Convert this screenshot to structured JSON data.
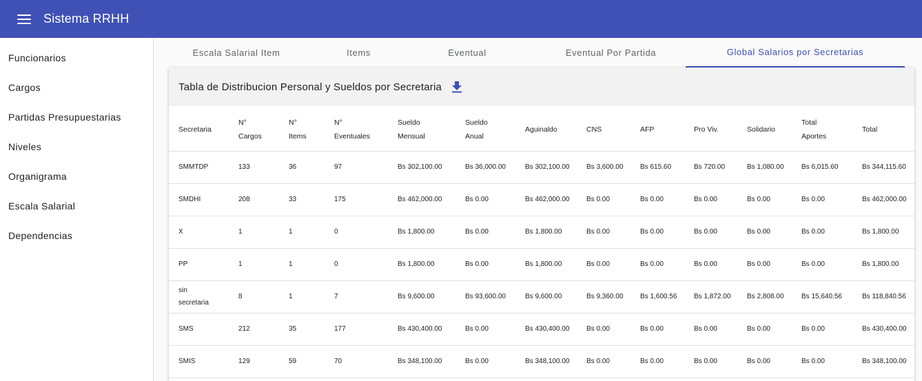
{
  "app": {
    "title": "Sistema RRHH"
  },
  "sidebar": {
    "items": [
      {
        "label": "Funcionarios"
      },
      {
        "label": "Cargos"
      },
      {
        "label": "Partidas Presupuestarias"
      },
      {
        "label": "Niveles"
      },
      {
        "label": "Organigrama"
      },
      {
        "label": "Escala Salarial"
      },
      {
        "label": "Dependencias"
      }
    ]
  },
  "tabs": [
    {
      "label": "Escala Salarial Item"
    },
    {
      "label": "Items"
    },
    {
      "label": "Eventual"
    },
    {
      "label": "Eventual Por Partida"
    },
    {
      "label": "Global Salarios por Secretarias"
    }
  ],
  "card": {
    "title": "Tabla de Distribucion Personal y Sueldos por Secretaria",
    "download_icon": "download-icon"
  },
  "table": {
    "headers": [
      "Secretaria",
      "N° Cargos",
      "N° Items",
      "N° Eventuales",
      "Sueldo Mensual",
      "Sueldo Anual",
      "Aguinaldo",
      "CNS",
      "AFP",
      "Pro Viv.",
      "Solidario",
      "Total Aportes",
      "Total"
    ],
    "rows": [
      [
        "SMMTDP",
        "133",
        "36",
        "97",
        "Bs 302,100.00",
        "Bs 36,000.00",
        "Bs 302,100.00",
        "Bs 3,600.00",
        "Bs 615.60",
        "Bs 720.00",
        "Bs 1,080.00",
        "Bs 6,015.60",
        "Bs 344,115.60"
      ],
      [
        "SMDHI",
        "208",
        "33",
        "175",
        "Bs 462,000.00",
        "Bs 0.00",
        "Bs 462,000.00",
        "Bs 0.00",
        "Bs 0.00",
        "Bs 0.00",
        "Bs 0.00",
        "Bs 0.00",
        "Bs 462,000.00"
      ],
      [
        "X",
        "1",
        "1",
        "0",
        "Bs 1,800.00",
        "Bs 0.00",
        "Bs 1,800.00",
        "Bs 0.00",
        "Bs 0.00",
        "Bs 0.00",
        "Bs 0.00",
        "Bs 0.00",
        "Bs 1,800.00"
      ],
      [
        "PP",
        "1",
        "1",
        "0",
        "Bs 1,800.00",
        "Bs 0.00",
        "Bs 1,800.00",
        "Bs 0.00",
        "Bs 0.00",
        "Bs 0.00",
        "Bs 0.00",
        "Bs 0.00",
        "Bs 1,800.00"
      ],
      [
        "sin secretaria",
        "8",
        "1",
        "7",
        "Bs 9,600.00",
        "Bs 93,600.00",
        "Bs 9,600.00",
        "Bs 9,360.00",
        "Bs 1,600.56",
        "Bs 1,872.00",
        "Bs 2,808.00",
        "Bs 15,640.56",
        "Bs 118,840.56"
      ],
      [
        "SMS",
        "212",
        "35",
        "177",
        "Bs 430,400.00",
        "Bs 0.00",
        "Bs 430,400.00",
        "Bs 0.00",
        "Bs 0.00",
        "Bs 0.00",
        "Bs 0.00",
        "Bs 0.00",
        "Bs 430,400.00"
      ],
      [
        "SMIS",
        "129",
        "59",
        "70",
        "Bs 348,100.00",
        "Bs 0.00",
        "Bs 348,100.00",
        "Bs 0.00",
        "Bs 0.00",
        "Bs 0.00",
        "Bs 0.00",
        "Bs 0.00",
        "Bs 348,100.00"
      ]
    ]
  }
}
